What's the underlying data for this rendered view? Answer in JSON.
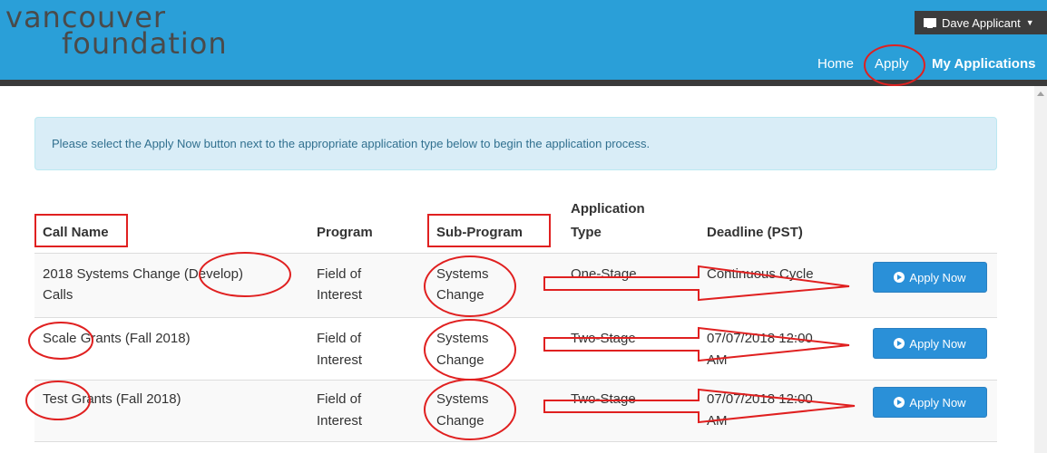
{
  "header": {
    "logo_line1": "vancouver",
    "logo_line2": "foundation",
    "user_label": "Dave Applicant",
    "nav": {
      "home": "Home",
      "apply": "Apply",
      "my_applications": "My Applications"
    },
    "colors": {
      "bar": "#2a9fd8",
      "user_menu": "#3c3c3c"
    }
  },
  "info_message": "Please select the Apply Now button next to the appropriate application type below to begin the application process.",
  "table": {
    "headers": {
      "call_name": "Call Name",
      "program": "Program",
      "sub_program": "Sub-Program",
      "application_type_1": "Application",
      "application_type_2": "Type",
      "deadline": "Deadline (PST)"
    },
    "rows": [
      {
        "call_name_1": "2018 Systems Change (Develop)",
        "call_name_2": "Calls",
        "program_1": "Field of",
        "program_2": "Interest",
        "sub_program_1": "Systems",
        "sub_program_2": "Change",
        "type": "One-Stage",
        "deadline_1": "Continuous Cycle",
        "deadline_2": "",
        "button": "Apply Now"
      },
      {
        "call_name_1": "Scale Grants (Fall 2018)",
        "call_name_2": "",
        "program_1": "Field of",
        "program_2": "Interest",
        "sub_program_1": "Systems",
        "sub_program_2": "Change",
        "type": "Two-Stage",
        "deadline_1": "07/07/2018 12:00",
        "deadline_2": "AM",
        "button": "Apply Now"
      },
      {
        "call_name_1": "Test Grants (Fall 2018)",
        "call_name_2": "",
        "program_1": "Field of",
        "program_2": "Interest",
        "sub_program_1": "Systems",
        "sub_program_2": "Change",
        "type": "Two-Stage",
        "deadline_1": "07/07/2018 12:00",
        "deadline_2": "AM",
        "button": "Apply Now"
      }
    ]
  },
  "annotation_color": "#e02020"
}
